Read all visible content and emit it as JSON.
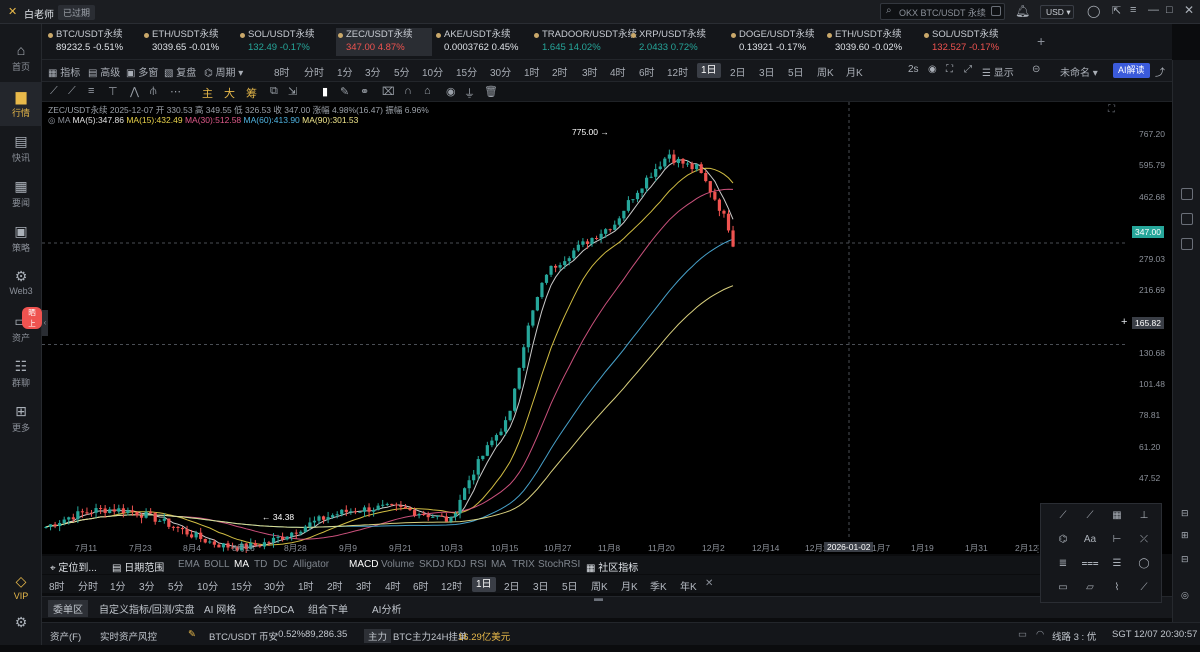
{
  "app": {
    "name": "白老师",
    "badge": "已过期"
  },
  "search": {
    "placeholder": "OKX BTC/USDT 永续"
  },
  "currency": "USD",
  "sidebar": {
    "items": [
      {
        "label": "首页",
        "icon": "home-icon"
      },
      {
        "label": "行情",
        "icon": "chart-bars-icon"
      },
      {
        "label": "快讯",
        "icon": "news-icon"
      },
      {
        "label": "要闻",
        "icon": "article-icon"
      },
      {
        "label": "策略",
        "icon": "strategy-icon"
      },
      {
        "label": "Web3",
        "icon": "web3-icon"
      },
      {
        "label": "资产",
        "icon": "wallet-icon"
      },
      {
        "label": "群聊",
        "icon": "chat-icon"
      },
      {
        "label": "更多",
        "icon": "grid-icon"
      }
    ],
    "asset_badge": "晒上",
    "vip": "VIP"
  },
  "tickers": [
    {
      "name": "BTC/USDT永续",
      "price": "89232.5",
      "change": "-0.51%",
      "dir": "wh"
    },
    {
      "name": "ETH/USDT永续",
      "price": "3039.65",
      "change": "-0.01%",
      "dir": "wh"
    },
    {
      "name": "SOL/USDT永续",
      "price": "132.49",
      "change": "-0.17%",
      "dir": "up"
    },
    {
      "name": "ZEC/USDT永续",
      "price": "347.00",
      "change": "4.87%",
      "dir": "dn"
    },
    {
      "name": "AKE/USDT永续",
      "price": "0.0003762",
      "change": "0.45%",
      "dir": "wh"
    },
    {
      "name": "TRADOOR/USDT永续",
      "price": "1.645",
      "change": "14.02%",
      "dir": "up"
    },
    {
      "name": "XRP/USDT永续",
      "price": "2.0433",
      "change": "0.72%",
      "dir": "up"
    },
    {
      "name": "DOGE/USDT永续",
      "price": "0.13921",
      "change": "-0.17%",
      "dir": "wh"
    },
    {
      "name": "ETH/USDT永续",
      "price": "3039.60",
      "change": "-0.02%",
      "dir": "wh"
    },
    {
      "name": "SOL/USDT永续",
      "price": "132.527",
      "change": "-0.17%",
      "dir": "dn"
    }
  ],
  "toolbar": {
    "left": [
      "指标",
      "高级",
      "多窗",
      "复盘",
      "周期"
    ],
    "periods": [
      "8时",
      "分时",
      "1分",
      "3分",
      "5分",
      "10分",
      "15分",
      "30分",
      "1时",
      "2时",
      "3时",
      "4时",
      "6时",
      "12时",
      "1日",
      "2日",
      "3日",
      "5日",
      "周K",
      "月K"
    ],
    "active_period": "1日",
    "right": {
      "speed": "2s",
      "display": "显示",
      "layout": "未命名",
      "ai": "AI解读"
    }
  },
  "draw_tools": {
    "labels": [
      "主",
      "大",
      "筹"
    ]
  },
  "legend": {
    "line1": "ZEC/USDT永续 2025-12-07 开 330.53 高 349.55 低 326.53 收 347.00 涨幅 4.98%(16.47) 振幅 6.96%",
    "ma_label": "MA",
    "ma": [
      {
        "text": "MA(5):347.86",
        "color": "#e0e0e0"
      },
      {
        "text": "MA(15):432.49",
        "color": "#e8d24a"
      },
      {
        "text": "MA(30):512.58",
        "color": "#e05a8a"
      },
      {
        "text": "MA(60):413.90",
        "color": "#4fb3e0"
      },
      {
        "text": "MA(90):301.53",
        "color": "#f0e68c"
      }
    ]
  },
  "chart": {
    "y_ticks": [
      "767.20",
      "595.79",
      "462.68",
      "359.31",
      "279.03",
      "216.69",
      "168.27",
      "130.68",
      "101.48",
      "78.81",
      "61.20",
      "47.52"
    ],
    "x_ticks": [
      "7月11",
      "7月23",
      "8月4",
      "8月16",
      "8月28",
      "9月9",
      "9月21",
      "10月3",
      "10月15",
      "10月27",
      "11月8",
      "11月20",
      "12月2",
      "12月14",
      "12月26",
      "2026-01-02",
      "1月7",
      "1月19",
      "1月31",
      "2月12"
    ],
    "current_price": "347.00",
    "crosshair_price": "165.82",
    "high_label": "775.00",
    "low_label": "34.38",
    "colors": {
      "up": "#26a69a",
      "down": "#ef5350"
    }
  },
  "chart_data": {
    "type": "candlestick",
    "scale": "log",
    "ylim": [
      40,
      900
    ],
    "series": [
      {
        "name": "MA(5)",
        "color": "#e0e0e0"
      },
      {
        "name": "MA(15)",
        "color": "#e8d24a"
      },
      {
        "name": "MA(30)",
        "color": "#e05a8a"
      },
      {
        "name": "MA(60)",
        "color": "#4fb3e0"
      },
      {
        "name": "MA(90)",
        "color": "#f0e68c"
      }
    ]
  },
  "indicators": {
    "labels": [
      "定位到...",
      "日期范围",
      "EMA",
      "BOLL",
      "MA",
      "TD",
      "DC",
      "Alligator",
      "MACD",
      "Volume",
      "SKDJ",
      "KDJ",
      "RSI",
      "MA",
      "TRIX",
      "StochRSI",
      "社区指标"
    ],
    "active": [
      "MA",
      "MACD"
    ]
  },
  "periods2": {
    "labels": [
      "8时",
      "分时",
      "1分",
      "3分",
      "5分",
      "10分",
      "15分",
      "30分",
      "1时",
      "2时",
      "3时",
      "4时",
      "6时",
      "12时",
      "1日",
      "2日",
      "3日",
      "5日",
      "周K",
      "月K",
      "季K",
      "年K"
    ],
    "active": "1日"
  },
  "bottom_tabs": [
    "委单区",
    "自定义指标/回测/实盘",
    "AI 网格",
    "合约DCA",
    "组合下单",
    "AI分析"
  ],
  "status": {
    "asset": "资产(F)",
    "risk": "实时资产风控",
    "btc_label": "BTC/USDT 币安",
    "btc_change": "-0.52%",
    "btc_price": "89,286.35",
    "main_force": "主力",
    "main_text": "BTC主力24H挂单",
    "main_value": "16.29亿美元",
    "line": "线路 3 : 优",
    "time": "SGT 12/07 20:30:57"
  }
}
